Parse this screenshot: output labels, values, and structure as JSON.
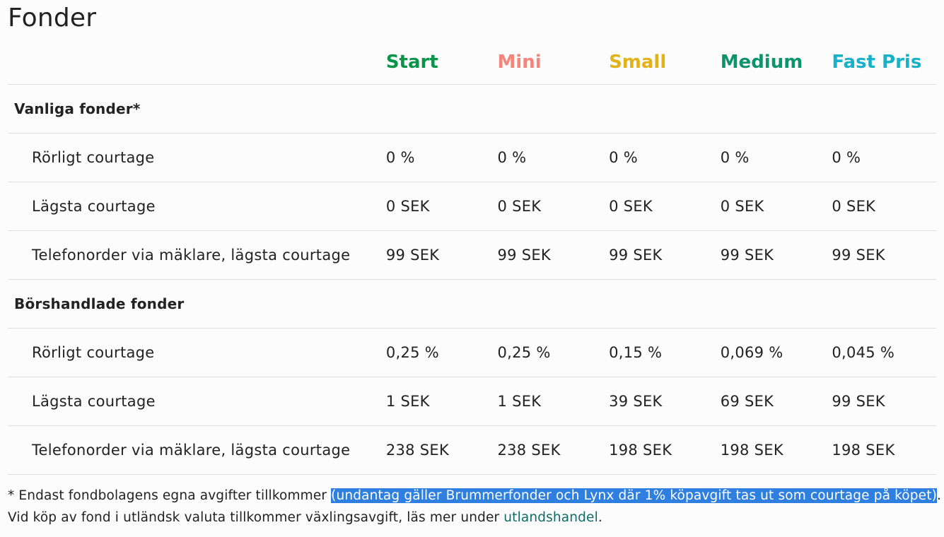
{
  "page": {
    "title": "Fonder"
  },
  "colors": {
    "start": "#0a9447",
    "mini": "#f3857a",
    "small": "#e1b21a",
    "medium": "#0e9468",
    "fast_pris": "#17b1c8"
  },
  "plans": [
    {
      "label": "Start"
    },
    {
      "label": "Mini"
    },
    {
      "label": "Small"
    },
    {
      "label": "Medium"
    },
    {
      "label": "Fast Pris"
    }
  ],
  "sections": [
    {
      "title": "Vanliga fonder*",
      "rows": [
        {
          "label": "Rörligt courtage",
          "values": [
            "0 %",
            "0 %",
            "0 %",
            "0 %",
            "0 %"
          ]
        },
        {
          "label": "Lägsta courtage",
          "values": [
            "0 SEK",
            "0 SEK",
            "0 SEK",
            "0 SEK",
            "0 SEK"
          ]
        },
        {
          "label": "Telefonorder via mäklare, lägsta courtage",
          "values": [
            "99 SEK",
            "99 SEK",
            "99 SEK",
            "99 SEK",
            "99 SEK"
          ]
        }
      ]
    },
    {
      "title": "Börshandlade fonder",
      "rows": [
        {
          "label": "Rörligt courtage",
          "values": [
            "0,25 %",
            "0,25 %",
            "0,15 %",
            "0,069 %",
            "0,045 %"
          ]
        },
        {
          "label": "Lägsta courtage",
          "values": [
            "1 SEK",
            "1 SEK",
            "39 SEK",
            "69 SEK",
            "99 SEK"
          ]
        },
        {
          "label": "Telefonorder via mäklare, lägsta courtage",
          "values": [
            "238 SEK",
            "238 SEK",
            "198 SEK",
            "198 SEK",
            "198 SEK"
          ]
        }
      ]
    }
  ],
  "footnote": {
    "line1_prefix": "* Endast fondbolagens egna avgifter tillkommer ",
    "line1_highlight": "(undantag gäller Brummerfonder och Lynx där 1% köpavgift tas ut som courtage på köpet)",
    "line1_suffix": ".",
    "line2_prefix": "Vid köp av fond i utländsk valuta tillkommer växlingsavgift, läs mer under ",
    "line2_link": "utlandshandel",
    "line2_suffix": "."
  }
}
